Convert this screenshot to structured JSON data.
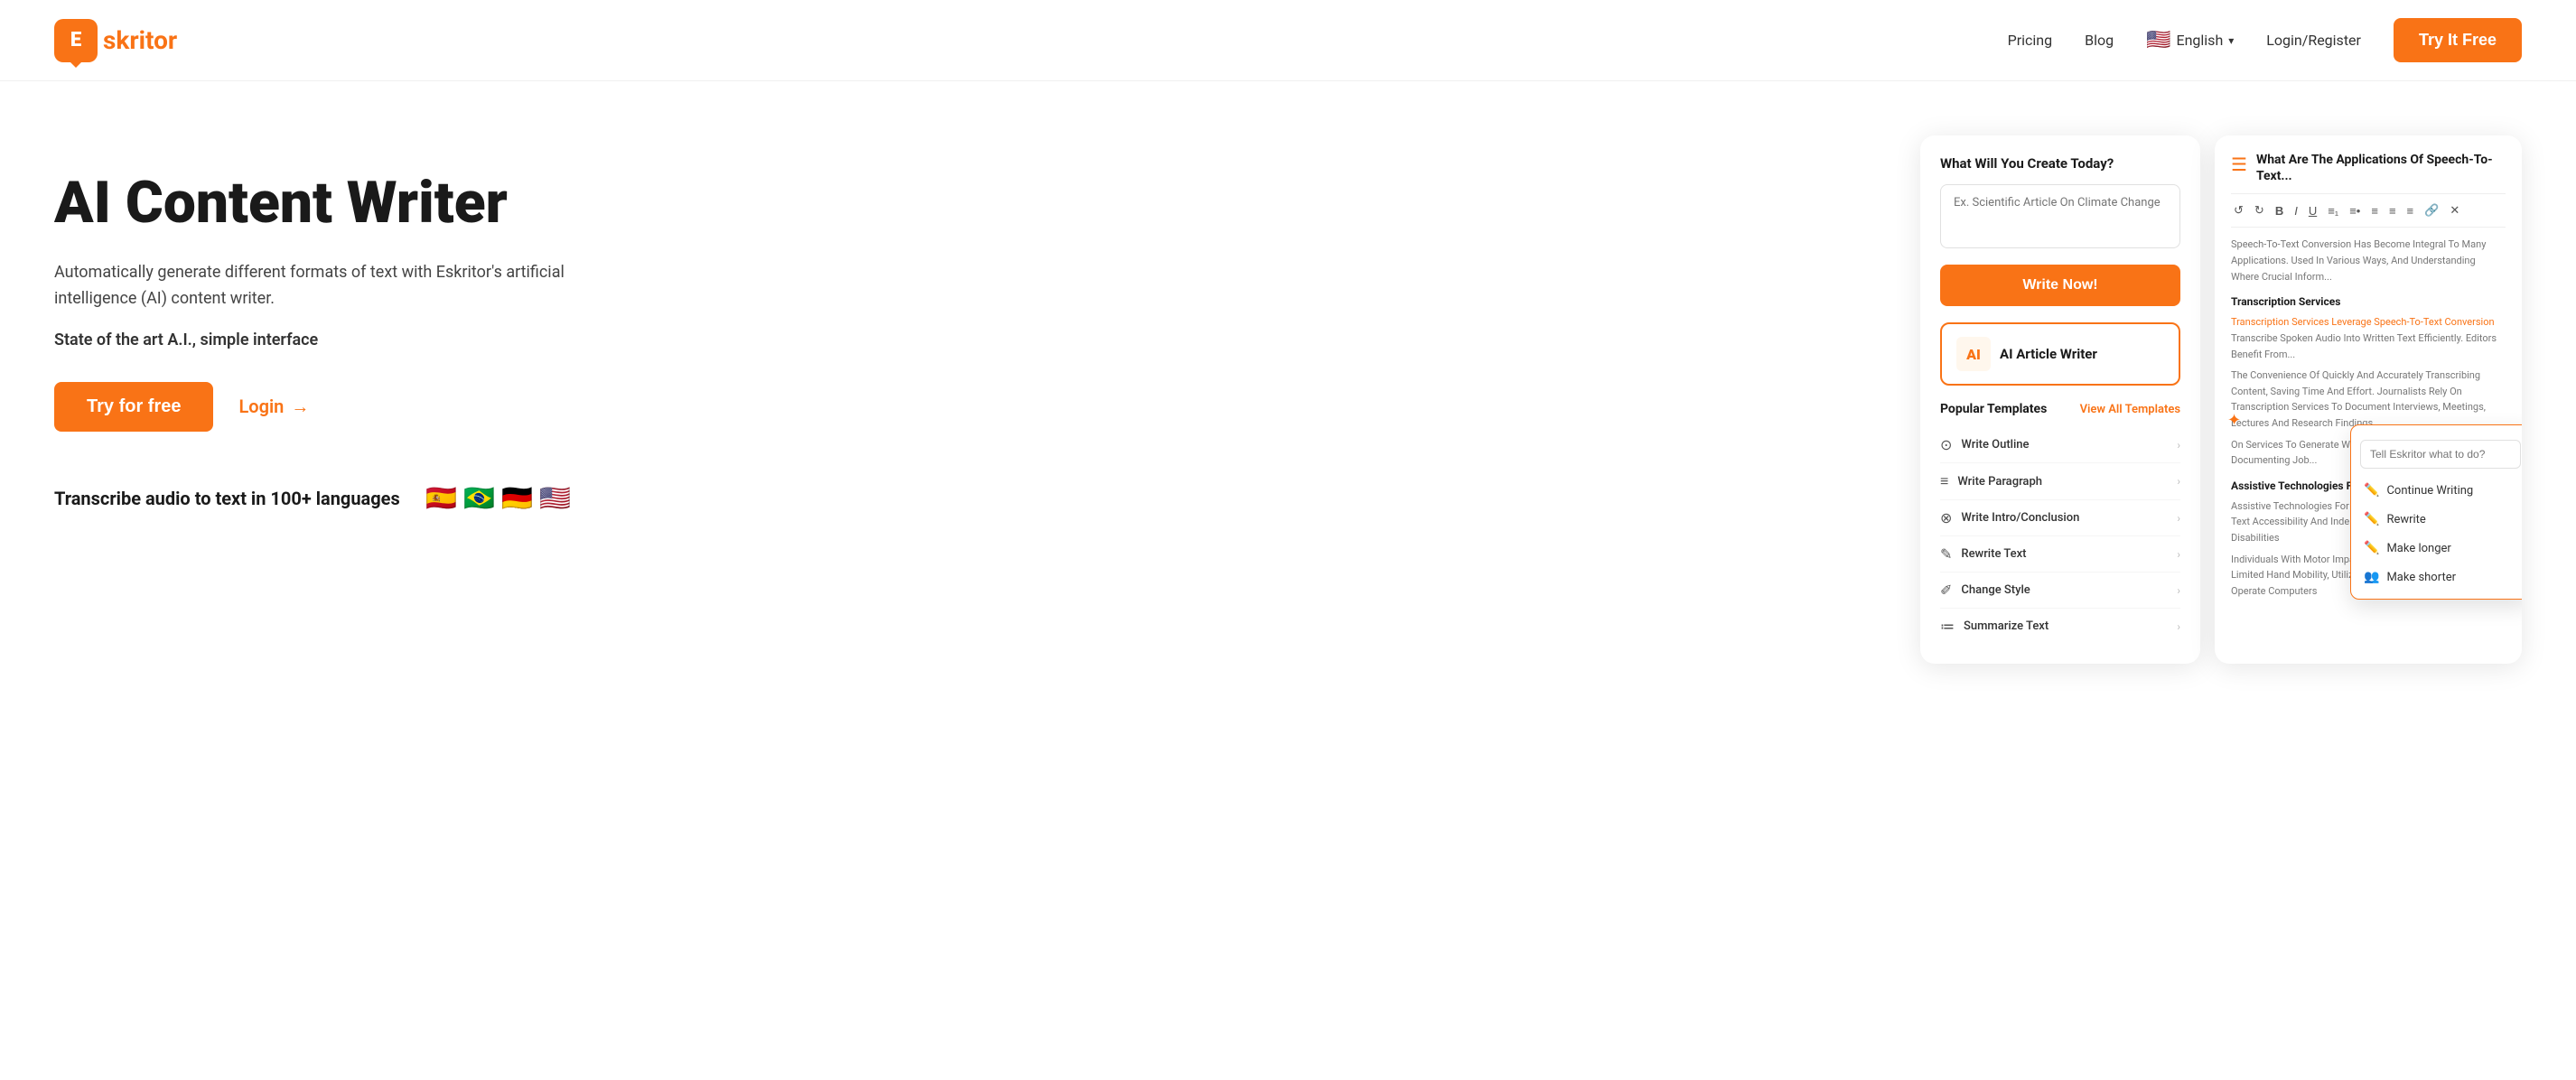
{
  "header": {
    "logo_letter": "E",
    "logo_text": "skritor",
    "nav": {
      "pricing": "Pricing",
      "blog": "Blog",
      "language": "English",
      "login_register": "Login/Register",
      "try_free": "Try It Free"
    }
  },
  "hero": {
    "title": "AI Content Writer",
    "subtitle": "Automatically generate different formats of text with Eskritor's artificial intelligence (AI) content writer.",
    "subtitle2": "State of the art A.I., simple interface",
    "cta_primary": "Try for free",
    "cta_login": "Login",
    "cta_login_arrow": "→",
    "transcribe_text": "Transcribe audio to text in 100+ languages"
  },
  "writer_panel": {
    "title": "What Will You Create Today?",
    "input_placeholder": "Ex. Scientific Article On Climate Change",
    "write_now": "Write Now!",
    "ai_card_label": "AI Article Writer",
    "templates_title": "Popular Templates",
    "view_all": "View All Templates",
    "templates": [
      {
        "icon": "⊙",
        "name": "Write Outline"
      },
      {
        "icon": "≡",
        "name": "Write Paragraph"
      },
      {
        "icon": "⊗",
        "name": "Write Intro/Conclusion"
      },
      {
        "icon": "✎",
        "name": "Rewrite Text"
      },
      {
        "icon": "✐",
        "name": "Change Style"
      },
      {
        "icon": "≔",
        "name": "Summarize Text"
      }
    ]
  },
  "editor_panel": {
    "title": "What Are The Applications Of Speech-To-Text...",
    "section1": "Transcription Services",
    "text1": "Transcription Services Leverage Speech-To-Text Conversion Transcribe Spoken Audio Into Written Text Efficiently.",
    "text2": "Editors Benefit From The Convenience Of Quickly And Accurately Transcribing Content, Saving Time And Effort. Journalists Rely On Transcription Services To Document Interviews, Meetings, Lectures And Research Findings",
    "section2": "Assistive Technologies For The Disabled",
    "text3": "Assistive Technologies For The Disabled Leverage Speech-To-Text Accessibility And Independence For Users With Disabilities",
    "text4": "Individuals With Motor Impairments, Such As Paralysis Or Limited Hand Mobility, Utilize Speech-To-Text Converters To Operate Computers"
  },
  "dropdown": {
    "placeholder": "Tell Eskritor what to do?",
    "items": [
      {
        "icon": "✏️",
        "label": "Continue Writing"
      },
      {
        "icon": "✏️",
        "label": "Rewrite"
      },
      {
        "icon": "✏️",
        "label": "Make longer"
      },
      {
        "icon": "👥",
        "label": "Make shorter"
      }
    ]
  },
  "colors": {
    "orange": "#f97316",
    "dark": "#1a1a1a",
    "gray": "#555",
    "light_gray": "#f5f5f5"
  }
}
